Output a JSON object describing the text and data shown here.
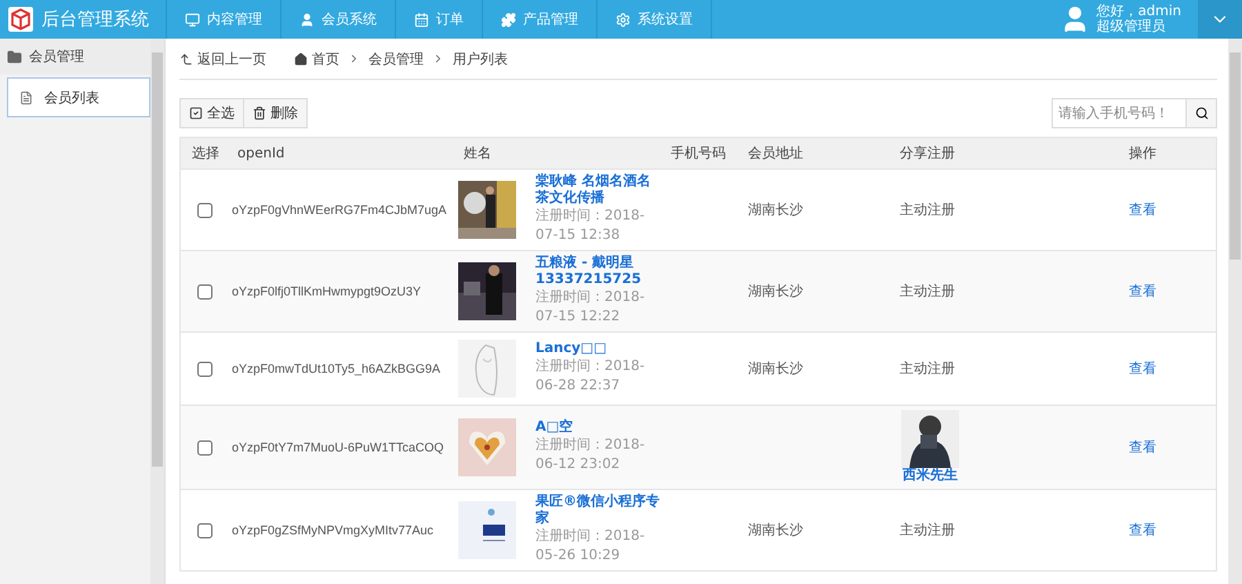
{
  "app": {
    "title": "后台管理系统"
  },
  "nav": [
    {
      "label": "内容管理"
    },
    {
      "label": "会员系统"
    },
    {
      "label": "订单"
    },
    {
      "label": "产品管理"
    },
    {
      "label": "系统设置"
    }
  ],
  "user": {
    "greeting": "您好，admin",
    "role": "超级管理员"
  },
  "sidebar": {
    "group": "会员管理",
    "items": [
      {
        "label": "会员列表",
        "selected": true
      }
    ]
  },
  "breadcrumb": {
    "back": "返回上一页",
    "items": [
      "首页",
      "会员管理",
      "用户列表"
    ]
  },
  "toolbar": {
    "buttons": [
      {
        "label": "全选"
      },
      {
        "label": "删除"
      }
    ],
    "search": {
      "placeholder": "请输入手机号码！"
    }
  },
  "table": {
    "columns": [
      "选择",
      "openId",
      "姓名",
      "手机号码",
      "会员地址",
      "分享注册",
      "操作"
    ],
    "rows": [
      {
        "checked": false,
        "openid": "oYzpF0gVhnWEerRG7Fm4CJbM7ugA",
        "name": "棠耿峰 名烟名酒名茶文化传播",
        "registered": "注册时间：2018-07-15 12:38",
        "address": "湖南长沙",
        "share": {
          "kind": "text",
          "text": "主动注册"
        },
        "action": "查看"
      },
      {
        "checked": false,
        "openid": "oYzpF0lfj0TllKmHwmypgt9OzU3Y",
        "name": "五粮液 - 戴明星 13337215725",
        "registered": "注册时间：2018-07-15 12:22",
        "address": "湖南长沙",
        "share": {
          "kind": "text",
          "text": "主动注册"
        },
        "action": "查看"
      },
      {
        "checked": false,
        "openid": "oYzpF0mwTdUt10Ty5_h6AZkBGG9A",
        "name": "Lancy□□",
        "registered": "注册时间：2018-06-28 22:37",
        "address": "湖南长沙",
        "share": {
          "kind": "text",
          "text": "主动注册"
        },
        "action": "查看"
      },
      {
        "checked": false,
        "openid": "oYzpF0tY7m7MuoU-6PuW1TTcaCOQ",
        "name": "A□空",
        "registered": "注册时间：2018-06-12 23:02",
        "share": {
          "kind": "referrer",
          "text": "西米先生"
        },
        "action": "查看"
      },
      {
        "checked": false,
        "openid": "oYzpF0gZSfMyNPVmgXyMItv77Auc",
        "name": "果匠®微信小程序专家",
        "registered": "注册时间：2018-05-26 10:29",
        "address": "湖南长沙",
        "share": {
          "kind": "text",
          "text": "主动注册"
        },
        "action": "查看"
      }
    ]
  }
}
